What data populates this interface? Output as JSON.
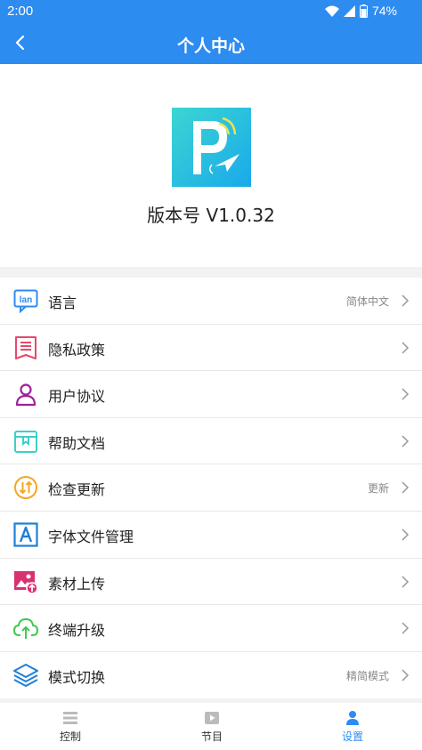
{
  "status_bar": {
    "time": "2:00",
    "battery": "74%"
  },
  "header": {
    "title": "个人中心"
  },
  "profile": {
    "version": "版本号 V1.0.32"
  },
  "menu": [
    {
      "label": "语言",
      "value": "简体中文",
      "icon": "language-icon"
    },
    {
      "label": "隐私政策",
      "value": "",
      "icon": "privacy-icon"
    },
    {
      "label": "用户协议",
      "value": "",
      "icon": "user-agreement-icon"
    },
    {
      "label": "帮助文档",
      "value": "",
      "icon": "help-doc-icon"
    },
    {
      "label": "检查更新",
      "value": "更新",
      "icon": "update-icon"
    },
    {
      "label": "字体文件管理",
      "value": "",
      "icon": "font-icon"
    },
    {
      "label": "素材上传",
      "value": "",
      "icon": "image-upload-icon"
    },
    {
      "label": "终端升级",
      "value": "",
      "icon": "cloud-upload-icon"
    },
    {
      "label": "模式切换",
      "value": "精简模式",
      "icon": "layers-icon"
    }
  ],
  "tabs": [
    {
      "label": "控制",
      "icon": "list-icon"
    },
    {
      "label": "节目",
      "icon": "play-icon"
    },
    {
      "label": "设置",
      "icon": "user-icon"
    }
  ],
  "colors": {
    "primary": "#2d8cf0",
    "background": "#f2f2f2"
  }
}
